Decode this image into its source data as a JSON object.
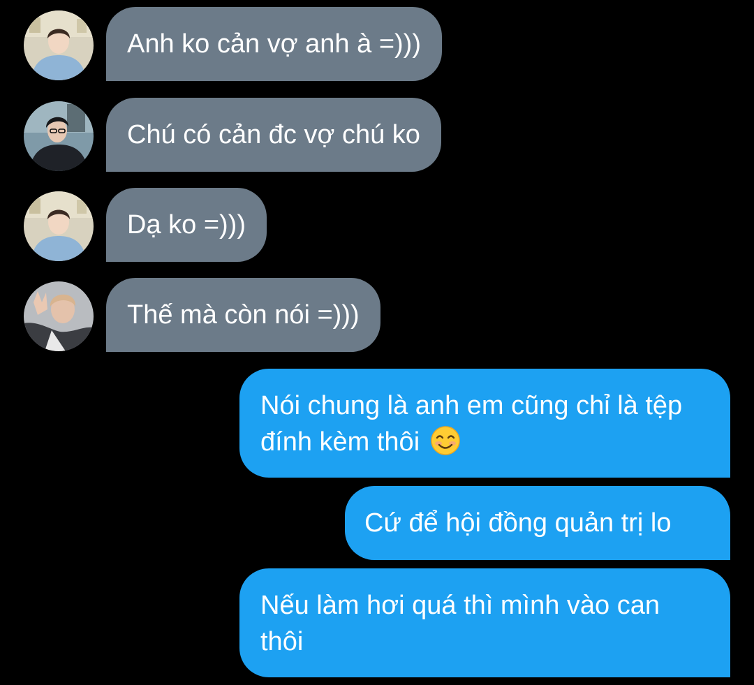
{
  "conversation": {
    "messages": [
      {
        "sender": "incoming",
        "avatar": "avatar-boy-blue-hoodie",
        "text": "Anh ko cản vợ anh à =)))"
      },
      {
        "sender": "incoming",
        "avatar": "avatar-boy-dark-jacket",
        "text": "Chú có cản đc vợ chú ko"
      },
      {
        "sender": "incoming",
        "avatar": "avatar-boy-blue-hoodie",
        "text": "Dạ ko =)))"
      },
      {
        "sender": "incoming",
        "avatar": "avatar-boy-peace-sign",
        "text": "Thế mà còn nói =)))"
      },
      {
        "sender": "outgoing",
        "text": "Nói chung là anh em cũng chỉ là tệp đính kèm thôi",
        "emoji": "smiling-face-icon"
      },
      {
        "sender": "outgoing",
        "text": "Cứ để hội đồng quản trị lo"
      },
      {
        "sender": "outgoing",
        "text": "Nếu làm hơi quá thì mình vào can thôi"
      }
    ]
  },
  "colors": {
    "background": "#000000",
    "incoming_bubble": "#6c7b89",
    "outgoing_bubble": "#1da1f2",
    "text": "#ffffff"
  }
}
